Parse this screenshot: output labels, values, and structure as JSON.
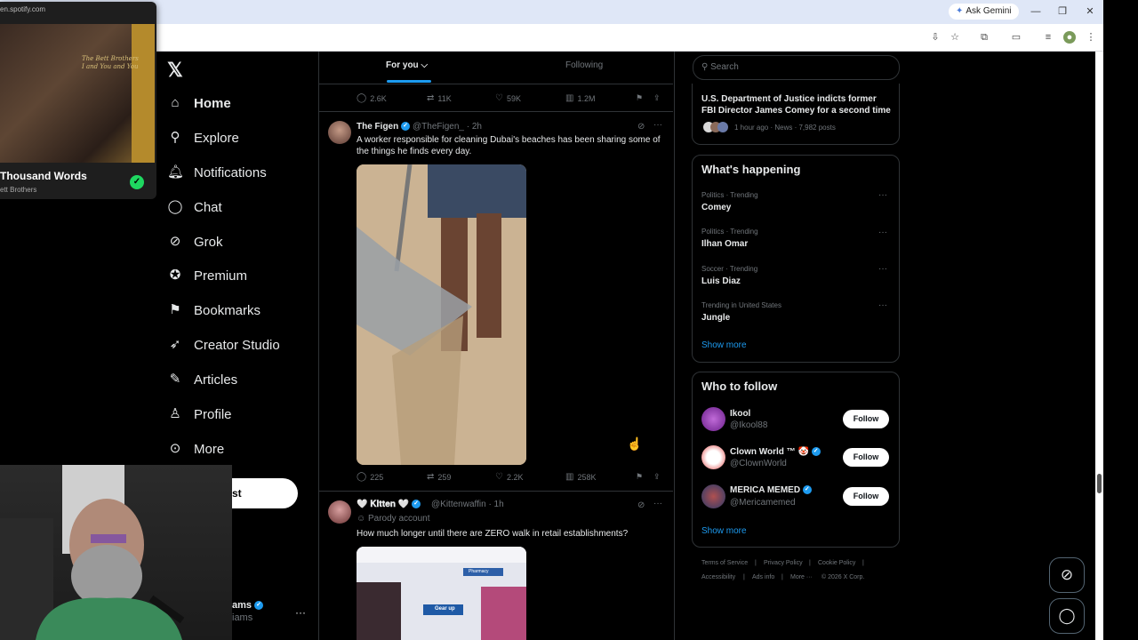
{
  "browser": {
    "ask_gemini": "Ask Gemini",
    "window_controls": {
      "minimize": "—",
      "restore": "❐",
      "close": "✕"
    }
  },
  "nav": {
    "items": [
      {
        "label": "Home",
        "icon": "home-icon"
      },
      {
        "label": "Explore",
        "icon": "search-icon"
      },
      {
        "label": "Notifications",
        "icon": "bell-icon"
      },
      {
        "label": "Chat",
        "icon": "chat-icon"
      },
      {
        "label": "Grok",
        "icon": "grok-icon"
      },
      {
        "label": "Premium",
        "icon": "premium-icon"
      },
      {
        "label": "Bookmarks",
        "icon": "bookmark-icon"
      },
      {
        "label": "Creator Studio",
        "icon": "rocket-icon"
      },
      {
        "label": "Articles",
        "icon": "article-icon"
      },
      {
        "label": "Profile",
        "icon": "person-icon"
      },
      {
        "label": "More",
        "icon": "more-circle-icon"
      }
    ],
    "post_button": "st",
    "account": {
      "name": "ams",
      "handle": "iams"
    }
  },
  "feed": {
    "tabs": {
      "for_you": "For you",
      "following": "Following"
    },
    "prev_actions": {
      "replies": "2.6K",
      "reposts": "11K",
      "likes": "59K",
      "views": "1.2M"
    },
    "posts": [
      {
        "name": "The Figen",
        "handle": "@TheFigen_ · 2h",
        "text": "A worker responsible for cleaning Dubai's beaches has been sharing some of the things he finds every day.",
        "actions": {
          "replies": "225",
          "reposts": "259",
          "likes": "2.2K",
          "views": "258K"
        }
      },
      {
        "name": "🤍 𝐊𝐢𝐭𝐭𝐞𝐧 🤍",
        "handle": "@Kittenwaffin · 1h",
        "badge": "Parody account",
        "text": "How much longer until there are ZERO walk in retail establishments?",
        "media_sign": "Gear up",
        "media_sign2": "Pharmacy"
      }
    ]
  },
  "sidebar": {
    "search_placeholder": "Search",
    "news": {
      "title": "U.S. Department of Justice indicts former FBI Director James Comey for a second time",
      "meta": "1 hour ago · News · 7,982 posts"
    },
    "whats_happening": {
      "heading": "What's happening",
      "trends": [
        {
          "context": "Politics · Trending",
          "name": "Comey"
        },
        {
          "context": "Politics · Trending",
          "name": "Ilhan Omar"
        },
        {
          "context": "Soccer · Trending",
          "name": "Luis Diaz"
        },
        {
          "context": "Trending in United States",
          "name": "Jungle"
        }
      ],
      "show_more": "Show more"
    },
    "who_to_follow": {
      "heading": "Who to follow",
      "users": [
        {
          "name": "Ikool",
          "handle": "@Ikool88",
          "button": "Follow"
        },
        {
          "name": "Clown World ™ 🤡",
          "handle": "@ClownWorld",
          "button": "Follow"
        },
        {
          "name": "MERICA MEMED",
          "handle": "@Mericamemed",
          "button": "Follow"
        }
      ],
      "show_more": "Show more"
    },
    "footer": [
      "Terms of Service",
      "Privacy Policy",
      "Cookie Policy",
      "Accessibility",
      "Ads info",
      "More ···",
      "© 2026 X Corp."
    ]
  },
  "pip_player": {
    "url": "en.spotify.com",
    "title": "Thousand Words",
    "artist": "ett Brothers",
    "album_text": "The Bett Brothers\nI and You and You"
  },
  "colors": {
    "accent": "#1d9bf0",
    "background": "#000000",
    "border": "#2f3336",
    "muted": "#71767b",
    "spotify_green": "#1ed760"
  }
}
